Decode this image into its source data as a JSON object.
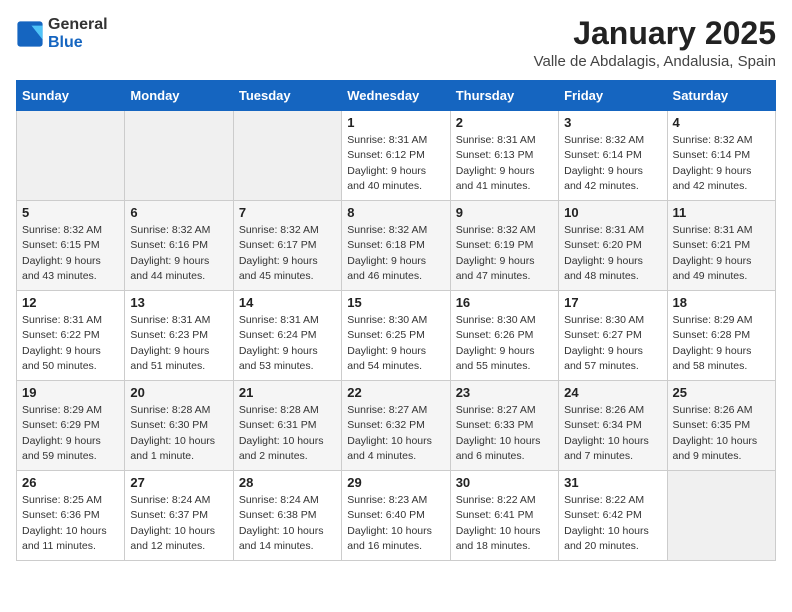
{
  "header": {
    "logo_general": "General",
    "logo_blue": "Blue",
    "title": "January 2025",
    "subtitle": "Valle de Abdalagis, Andalusia, Spain"
  },
  "weekdays": [
    "Sunday",
    "Monday",
    "Tuesday",
    "Wednesday",
    "Thursday",
    "Friday",
    "Saturday"
  ],
  "weeks": [
    [
      {
        "day": "",
        "info": ""
      },
      {
        "day": "",
        "info": ""
      },
      {
        "day": "",
        "info": ""
      },
      {
        "day": "1",
        "info": "Sunrise: 8:31 AM\nSunset: 6:12 PM\nDaylight: 9 hours\nand 40 minutes."
      },
      {
        "day": "2",
        "info": "Sunrise: 8:31 AM\nSunset: 6:13 PM\nDaylight: 9 hours\nand 41 minutes."
      },
      {
        "day": "3",
        "info": "Sunrise: 8:32 AM\nSunset: 6:14 PM\nDaylight: 9 hours\nand 42 minutes."
      },
      {
        "day": "4",
        "info": "Sunrise: 8:32 AM\nSunset: 6:14 PM\nDaylight: 9 hours\nand 42 minutes."
      }
    ],
    [
      {
        "day": "5",
        "info": "Sunrise: 8:32 AM\nSunset: 6:15 PM\nDaylight: 9 hours\nand 43 minutes."
      },
      {
        "day": "6",
        "info": "Sunrise: 8:32 AM\nSunset: 6:16 PM\nDaylight: 9 hours\nand 44 minutes."
      },
      {
        "day": "7",
        "info": "Sunrise: 8:32 AM\nSunset: 6:17 PM\nDaylight: 9 hours\nand 45 minutes."
      },
      {
        "day": "8",
        "info": "Sunrise: 8:32 AM\nSunset: 6:18 PM\nDaylight: 9 hours\nand 46 minutes."
      },
      {
        "day": "9",
        "info": "Sunrise: 8:32 AM\nSunset: 6:19 PM\nDaylight: 9 hours\nand 47 minutes."
      },
      {
        "day": "10",
        "info": "Sunrise: 8:31 AM\nSunset: 6:20 PM\nDaylight: 9 hours\nand 48 minutes."
      },
      {
        "day": "11",
        "info": "Sunrise: 8:31 AM\nSunset: 6:21 PM\nDaylight: 9 hours\nand 49 minutes."
      }
    ],
    [
      {
        "day": "12",
        "info": "Sunrise: 8:31 AM\nSunset: 6:22 PM\nDaylight: 9 hours\nand 50 minutes."
      },
      {
        "day": "13",
        "info": "Sunrise: 8:31 AM\nSunset: 6:23 PM\nDaylight: 9 hours\nand 51 minutes."
      },
      {
        "day": "14",
        "info": "Sunrise: 8:31 AM\nSunset: 6:24 PM\nDaylight: 9 hours\nand 53 minutes."
      },
      {
        "day": "15",
        "info": "Sunrise: 8:30 AM\nSunset: 6:25 PM\nDaylight: 9 hours\nand 54 minutes."
      },
      {
        "day": "16",
        "info": "Sunrise: 8:30 AM\nSunset: 6:26 PM\nDaylight: 9 hours\nand 55 minutes."
      },
      {
        "day": "17",
        "info": "Sunrise: 8:30 AM\nSunset: 6:27 PM\nDaylight: 9 hours\nand 57 minutes."
      },
      {
        "day": "18",
        "info": "Sunrise: 8:29 AM\nSunset: 6:28 PM\nDaylight: 9 hours\nand 58 minutes."
      }
    ],
    [
      {
        "day": "19",
        "info": "Sunrise: 8:29 AM\nSunset: 6:29 PM\nDaylight: 9 hours\nand 59 minutes."
      },
      {
        "day": "20",
        "info": "Sunrise: 8:28 AM\nSunset: 6:30 PM\nDaylight: 10 hours\nand 1 minute."
      },
      {
        "day": "21",
        "info": "Sunrise: 8:28 AM\nSunset: 6:31 PM\nDaylight: 10 hours\nand 2 minutes."
      },
      {
        "day": "22",
        "info": "Sunrise: 8:27 AM\nSunset: 6:32 PM\nDaylight: 10 hours\nand 4 minutes."
      },
      {
        "day": "23",
        "info": "Sunrise: 8:27 AM\nSunset: 6:33 PM\nDaylight: 10 hours\nand 6 minutes."
      },
      {
        "day": "24",
        "info": "Sunrise: 8:26 AM\nSunset: 6:34 PM\nDaylight: 10 hours\nand 7 minutes."
      },
      {
        "day": "25",
        "info": "Sunrise: 8:26 AM\nSunset: 6:35 PM\nDaylight: 10 hours\nand 9 minutes."
      }
    ],
    [
      {
        "day": "26",
        "info": "Sunrise: 8:25 AM\nSunset: 6:36 PM\nDaylight: 10 hours\nand 11 minutes."
      },
      {
        "day": "27",
        "info": "Sunrise: 8:24 AM\nSunset: 6:37 PM\nDaylight: 10 hours\nand 12 minutes."
      },
      {
        "day": "28",
        "info": "Sunrise: 8:24 AM\nSunset: 6:38 PM\nDaylight: 10 hours\nand 14 minutes."
      },
      {
        "day": "29",
        "info": "Sunrise: 8:23 AM\nSunset: 6:40 PM\nDaylight: 10 hours\nand 16 minutes."
      },
      {
        "day": "30",
        "info": "Sunrise: 8:22 AM\nSunset: 6:41 PM\nDaylight: 10 hours\nand 18 minutes."
      },
      {
        "day": "31",
        "info": "Sunrise: 8:22 AM\nSunset: 6:42 PM\nDaylight: 10 hours\nand 20 minutes."
      },
      {
        "day": "",
        "info": ""
      }
    ]
  ]
}
